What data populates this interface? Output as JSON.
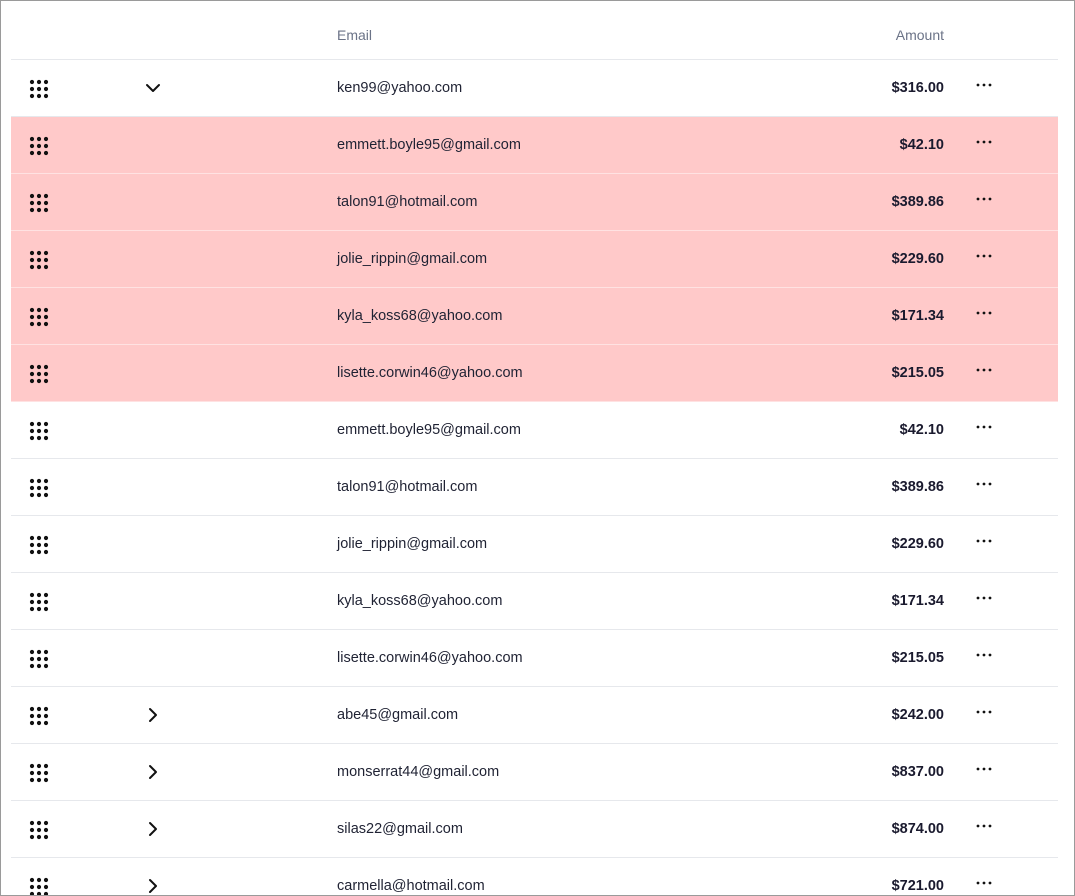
{
  "table": {
    "columns": {
      "email": "Email",
      "amount": "Amount"
    },
    "rows": [
      {
        "email": "ken99@yahoo.com",
        "amount": "$316.00",
        "type": "parent",
        "expanded": true
      },
      {
        "email": "emmett.boyle95@gmail.com",
        "amount": "$42.10",
        "type": "sub"
      },
      {
        "email": "talon91@hotmail.com",
        "amount": "$389.86",
        "type": "sub"
      },
      {
        "email": "jolie_rippin@gmail.com",
        "amount": "$229.60",
        "type": "sub"
      },
      {
        "email": "kyla_koss68@yahoo.com",
        "amount": "$171.34",
        "type": "sub"
      },
      {
        "email": "lisette.corwin46@yahoo.com",
        "amount": "$215.05",
        "type": "sub"
      },
      {
        "email": "emmett.boyle95@gmail.com",
        "amount": "$42.10",
        "type": "plain"
      },
      {
        "email": "talon91@hotmail.com",
        "amount": "$389.86",
        "type": "plain"
      },
      {
        "email": "jolie_rippin@gmail.com",
        "amount": "$229.60",
        "type": "plain"
      },
      {
        "email": "kyla_koss68@yahoo.com",
        "amount": "$171.34",
        "type": "plain"
      },
      {
        "email": "lisette.corwin46@yahoo.com",
        "amount": "$215.05",
        "type": "plain"
      },
      {
        "email": "abe45@gmail.com",
        "amount": "$242.00",
        "type": "parent",
        "expanded": false
      },
      {
        "email": "monserrat44@gmail.com",
        "amount": "$837.00",
        "type": "parent",
        "expanded": false
      },
      {
        "email": "silas22@gmail.com",
        "amount": "$874.00",
        "type": "parent",
        "expanded": false
      },
      {
        "email": "carmella@hotmail.com",
        "amount": "$721.00",
        "type": "parent",
        "expanded": false
      }
    ]
  },
  "icons": {
    "drag": "drag-handle-icon",
    "expanded": "chevron-down-icon",
    "collapsed": "chevron-right-icon",
    "more": "more-horizontal-icon"
  },
  "colors": {
    "sub_row_bg": "#ffc9c9",
    "header_text": "#6b7387",
    "divider": "#e6e8ec"
  }
}
